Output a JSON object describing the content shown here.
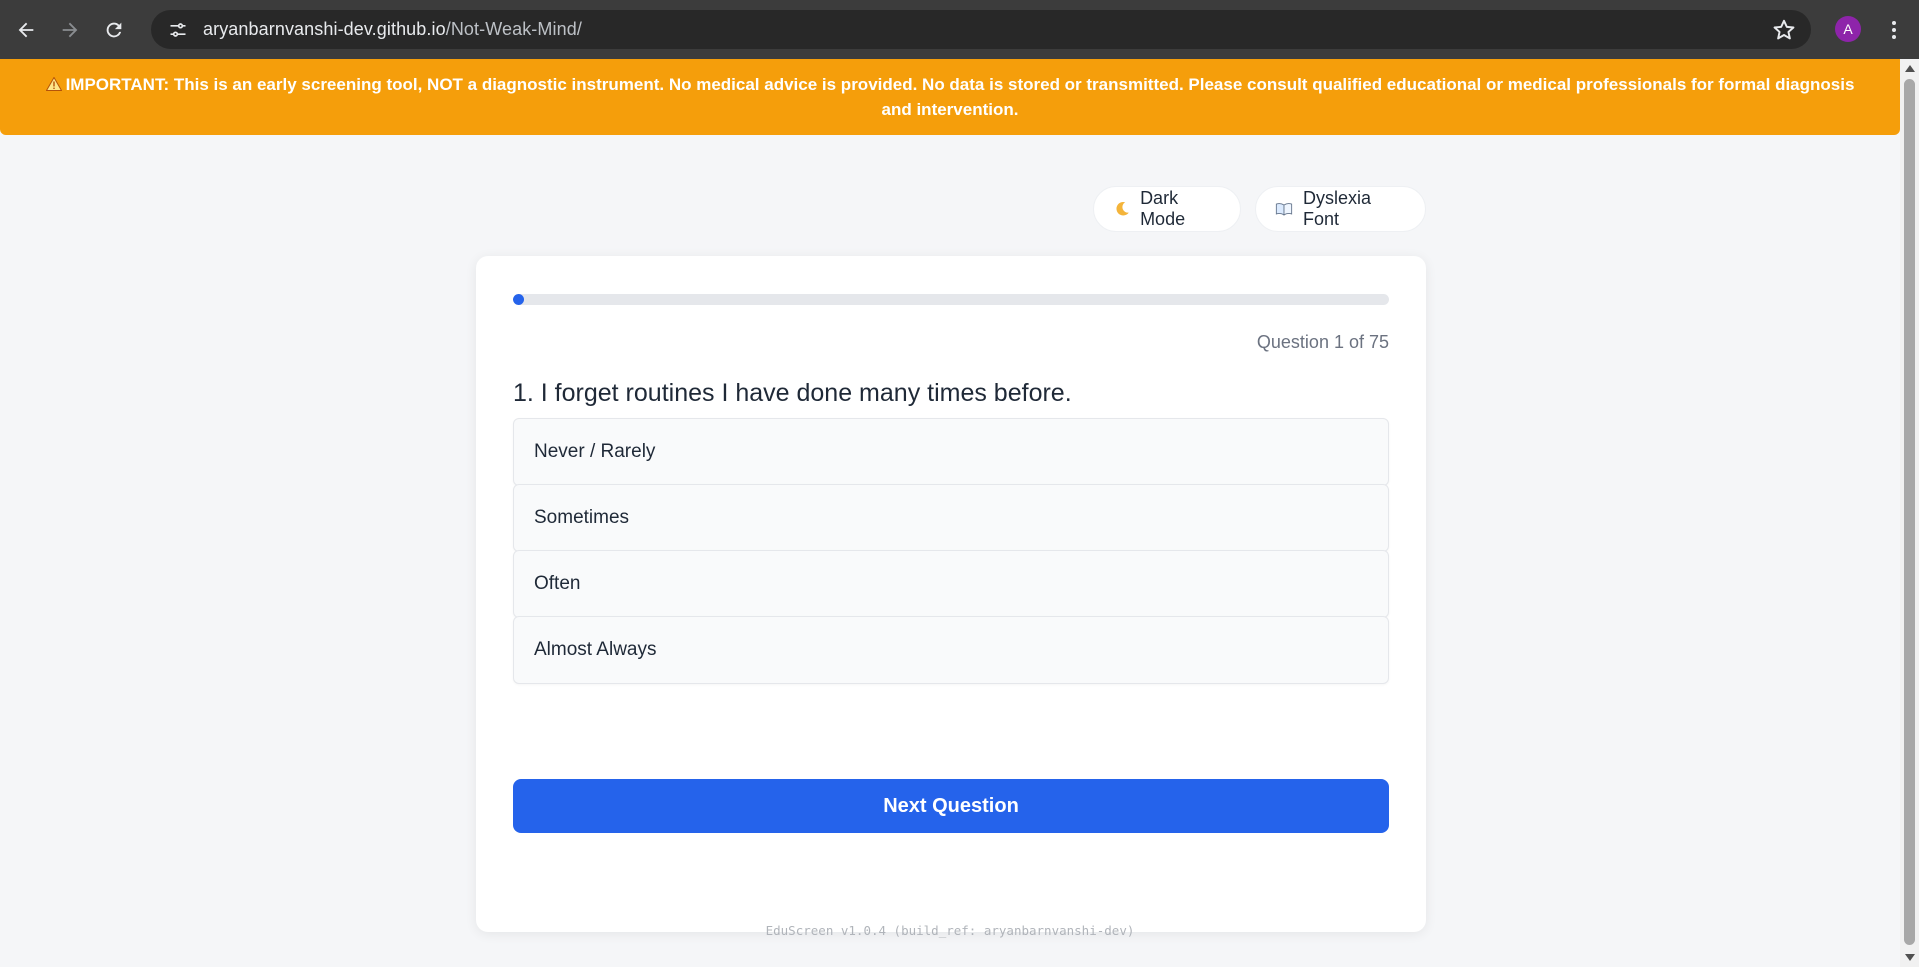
{
  "browser": {
    "url_host": "aryanbarnvanshi-dev.github.io",
    "url_path": "/Not-Weak-Mind/",
    "avatar_letter": "A"
  },
  "banner": {
    "icon": "warning-icon",
    "text": "IMPORTANT: This is an early screening tool, NOT a diagnostic instrument. No medical advice is provided. No data is stored or transmitted. Please consult qualified educational or medical professionals for formal diagnosis and intervention."
  },
  "toolbar": {
    "dark_mode_icon": "moon-icon",
    "dark_mode_label": "Dark Mode",
    "dyslexia_icon": "book-icon",
    "dyslexia_label": "Dyslexia Font"
  },
  "quiz": {
    "progress_fraction": 0.013,
    "counter": "Question 1 of 75",
    "question": "1. I forget routines I have done many times before.",
    "options": [
      {
        "label": "Never / Rarely"
      },
      {
        "label": "Sometimes"
      },
      {
        "label": "Often"
      },
      {
        "label": "Almost Always"
      }
    ],
    "next_label": "Next Question"
  },
  "footer": {
    "text": "EduScreen v1.0.4 (build_ref: aryanbarnvanshi-dev)"
  },
  "colors": {
    "banner": "#f59e0b",
    "primary": "#2563eb",
    "avatar": "#8e24aa"
  }
}
